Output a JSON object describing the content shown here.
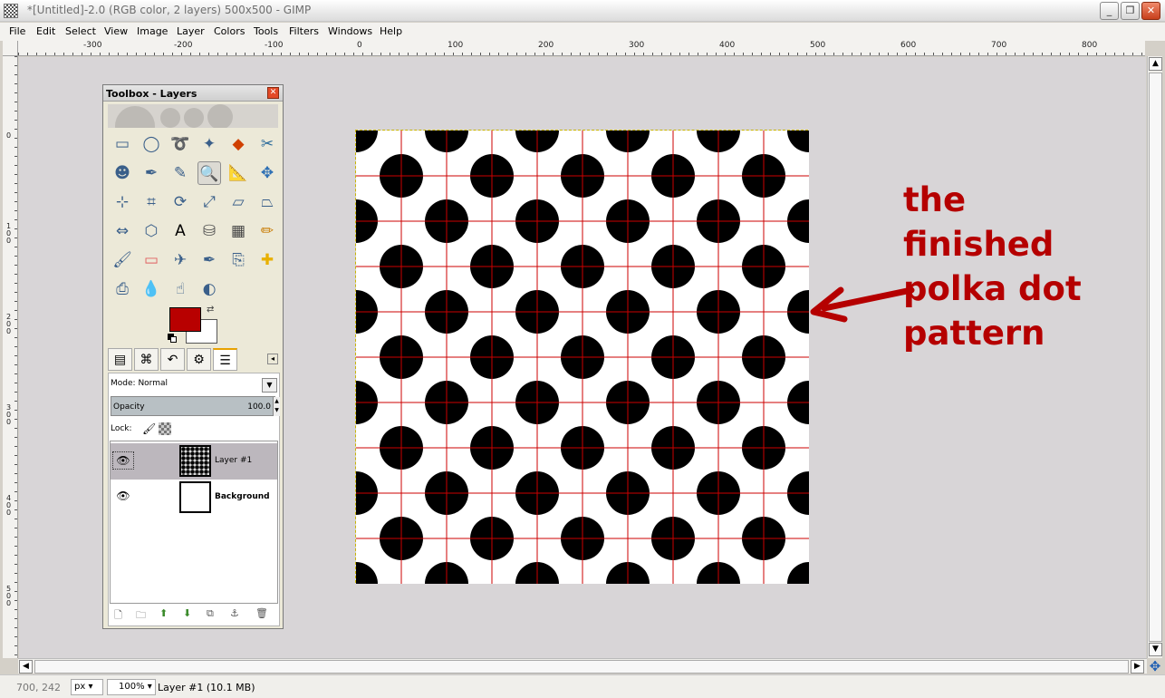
{
  "window": {
    "title": "*[Untitled]-2.0 (RGB color, 2 layers) 500x500 - GIMP",
    "buttons": {
      "minimize": "_",
      "restore": "❐",
      "close": "✕"
    }
  },
  "menu": [
    "File",
    "Edit",
    "Select",
    "View",
    "Image",
    "Layer",
    "Colors",
    "Tools",
    "Filters",
    "Windows",
    "Help"
  ],
  "hruler_labels": [
    "-300",
    "-200",
    "-100",
    "0",
    "100",
    "200",
    "300",
    "400",
    "500",
    "600",
    "700",
    "800"
  ],
  "vruler_labels": [
    "0",
    "100",
    "200",
    "300",
    "400",
    "500"
  ],
  "annotation": {
    "lines": [
      "the",
      "finished",
      "polka dot",
      "pattern"
    ],
    "color": "#b50000"
  },
  "image": {
    "width": 500,
    "height": 500,
    "dot_color": "#000000",
    "grid_color": "#cc0000",
    "grid_spacing": 50,
    "dot_spacing": 50
  },
  "toolbox": {
    "title": "Toolbox - Layers",
    "close": "✕",
    "tools": [
      "rect-select",
      "ellipse-select",
      "free-select",
      "fuzzy-select",
      "select-by-color",
      "scissors",
      "foreground-select",
      "paths",
      "color-picker",
      "zoom",
      "measure",
      "move",
      "align",
      "crop",
      "rotate",
      "scale",
      "shear",
      "perspective",
      "flip",
      "cage",
      "text",
      "bucket-fill",
      "blend",
      "pencil",
      "paintbrush",
      "eraser",
      "airbrush",
      "ink",
      "clone",
      "heal",
      "perspective-clone",
      "blur",
      "smudge",
      "dodge-burn"
    ],
    "fg_color": "#b80000",
    "bg_color": "#ffffff"
  },
  "layers": {
    "mode_label": "Mode:",
    "mode_value": "Normal",
    "opacity_label": "Opacity",
    "opacity_value": "100.0",
    "lock_label": "Lock:",
    "items": [
      {
        "name": "Layer #1",
        "selected": true,
        "visible": true
      },
      {
        "name": "Background",
        "selected": false,
        "visible": true
      }
    ]
  },
  "status": {
    "coords": "700, 242",
    "unit": "px",
    "zoom": "100%",
    "layer_info": "Layer #1 (10.1 MB)"
  }
}
